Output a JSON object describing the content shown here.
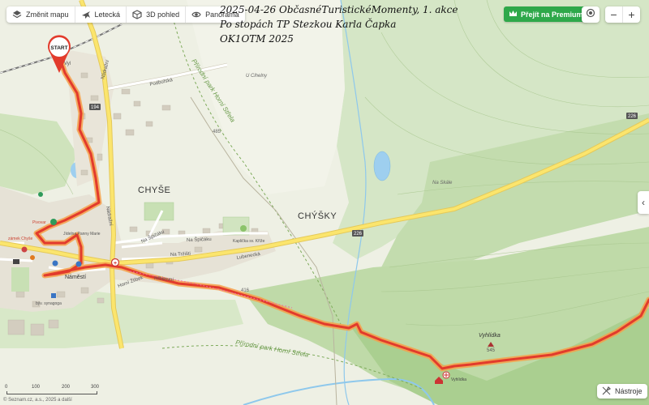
{
  "toolbar": {
    "change_map": "Změnit mapu",
    "aerial": "Letecká",
    "view_3d": "3D pohled",
    "panorama": "Panorama"
  },
  "title_lines": [
    "2025-04-26 ObčasnéTuristickéMomenty, 1. akce",
    "Po stopách TP Stezkou Karla Čapka",
    "OK1OTM 2025"
  ],
  "premium_label": "Přejít na Premium",
  "zoom": {
    "in": "+",
    "out": "−"
  },
  "tools_label": "Nástroje",
  "side_tab": "‹",
  "scale": {
    "labels": [
      "0",
      "100",
      "200",
      "300"
    ]
  },
  "copyright": "© Seznam.cz, a.s., 2025 a další",
  "map": {
    "start_label": "START",
    "places": {
      "chyse": "CHYŠE",
      "chysky": "CHÝŠKY",
      "vyhlidka": "Vyhlídka",
      "vyhlidka_ele": "545",
      "vyhlidka_small": "Vyhlídka",
      "u_cihelny": "U Cihelny",
      "na_skale": "Na Skále",
      "namesti": "Náměstí",
      "park_top": "Přírodní park Horní Střela",
      "park_bottom": "Přírodní park Horní Střela",
      "pivovar": "Pivovar",
      "jidelna": "Jídelna Panny Marie",
      "synagoga": "býv. synagoga",
      "kaple": "Kaplička sv. Kříže",
      "zamek": "zámek Chyše"
    },
    "streets": {
      "podbezna": "Podbořská",
      "nadrazni": "Nádražní",
      "lubenecka": "Lubenecká",
      "na_spicaku1": "Na Špičáku",
      "na_spicaku2": "Na Špičáku",
      "na_trzisti": "Na Tržišti",
      "hrbitovni": "Hřbitovní",
      "hor_zlecek": "Horní Žlíbek",
      "nadrazni2": "Nádražní",
      "vyl": "Vyl"
    },
    "road_numbers": [
      "194",
      "226",
      "226",
      "485",
      "416"
    ]
  }
}
